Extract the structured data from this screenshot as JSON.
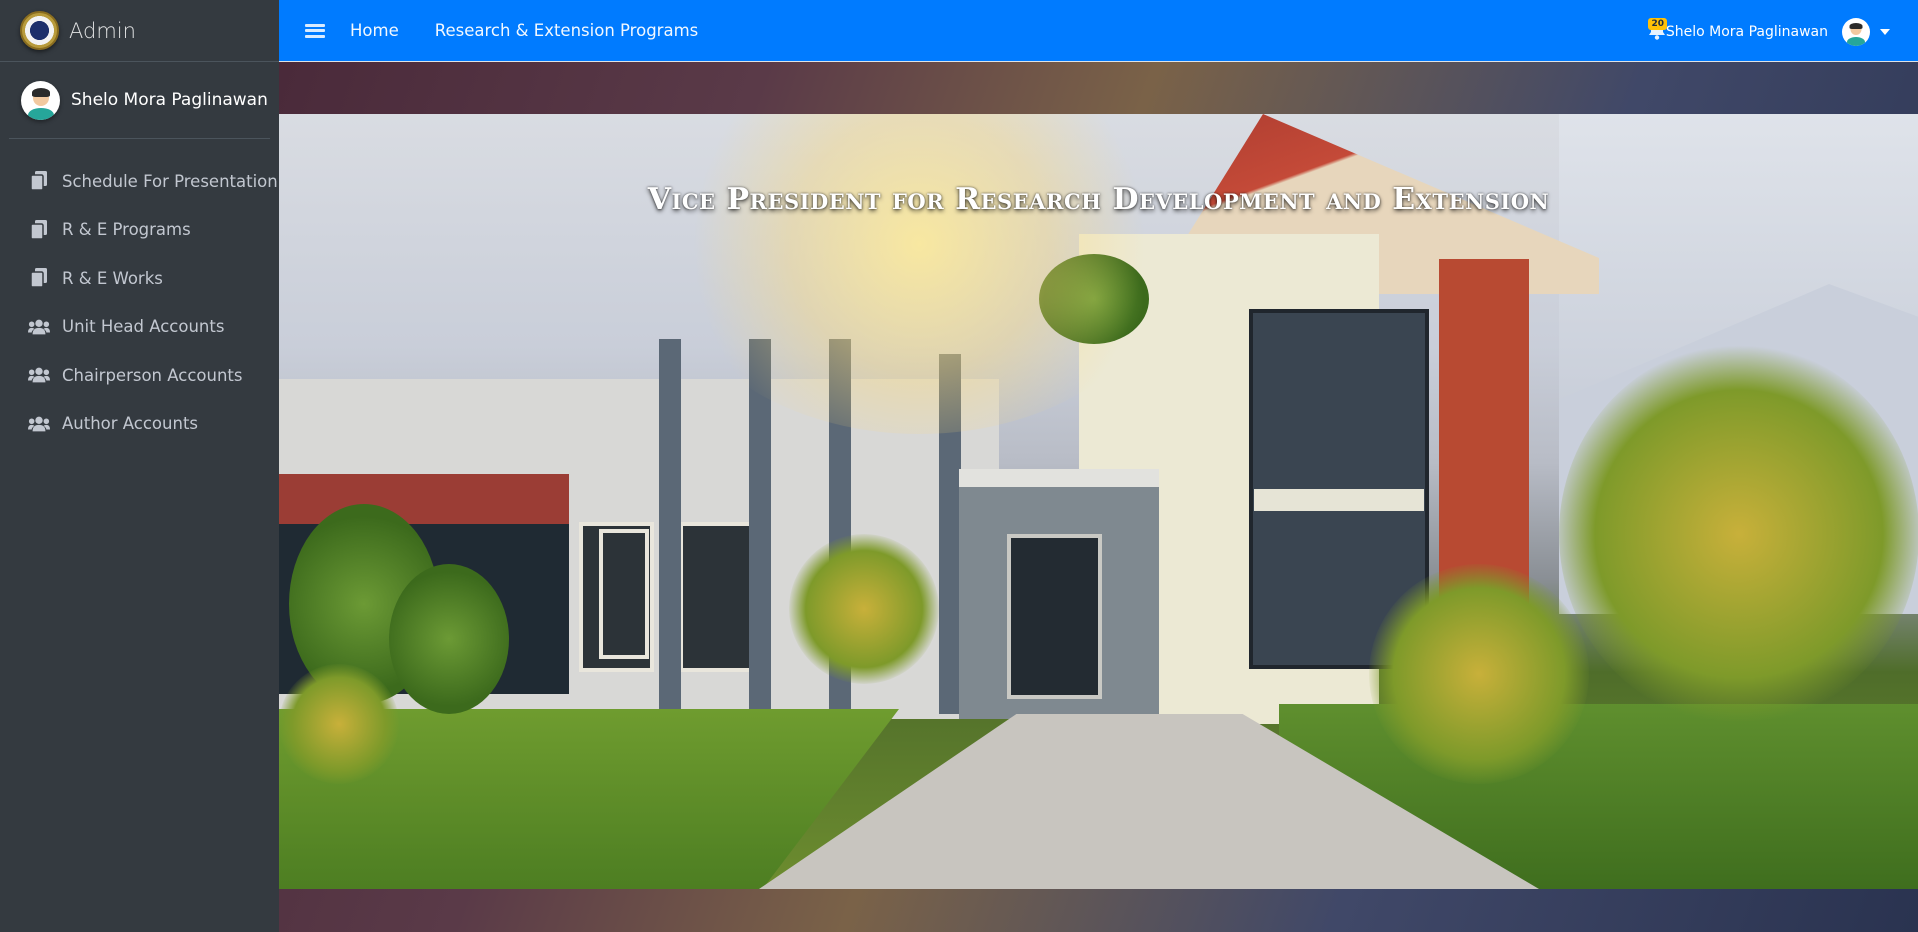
{
  "brand": {
    "title": "Admin",
    "logo": "university-seal-icon"
  },
  "sidebar": {
    "user_name": "Shelo Mora Paglinawan",
    "items": [
      {
        "label": "Schedule For Presentation",
        "icon": "copy-icon"
      },
      {
        "label": "R & E Programs",
        "icon": "copy-icon"
      },
      {
        "label": "R & E Works",
        "icon": "copy-icon"
      },
      {
        "label": "Unit Head Accounts",
        "icon": "users-icon"
      },
      {
        "label": "Chairperson Accounts",
        "icon": "users-icon"
      },
      {
        "label": "Author Accounts",
        "icon": "users-icon"
      }
    ]
  },
  "navbar": {
    "home_label": "Home",
    "programs_label": "Research & Extension Programs",
    "notification_count": "20",
    "user_name": "Shelo Mora Paglinawan"
  },
  "hero": {
    "title": "Vice President for Research Development and Extension"
  },
  "colors": {
    "sidebar_bg": "#343a40",
    "navbar_bg": "#007bff",
    "badge_bg": "#ffc107"
  }
}
